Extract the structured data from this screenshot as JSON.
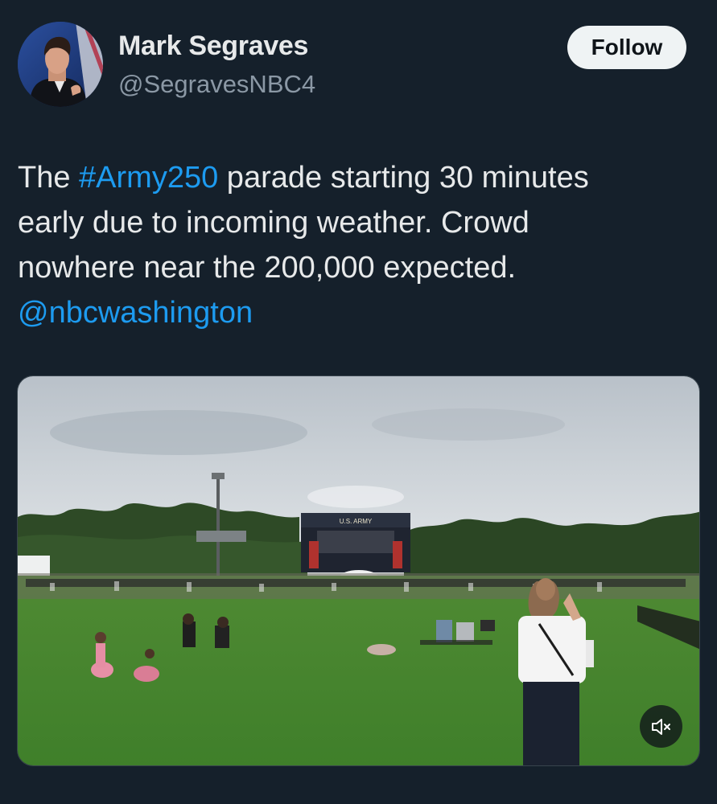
{
  "author": {
    "name": "Mark Segraves",
    "handle": "@SegravesNBC4",
    "avatar_icon": "profile-photo"
  },
  "follow_label": "Follow",
  "tweet": {
    "line1_pre": "The ",
    "hashtag": "#Army250",
    "line1_post": " parade starting 30 minutes",
    "line2": "early due to incoming weather. Crowd",
    "line3": "nowhere near the 200,000 expected.",
    "mention": "@nbcwashington"
  },
  "media": {
    "stage_banner": "U.S. ARMY",
    "mute_icon": "speaker-muted-icon"
  },
  "colors": {
    "background": "#15202b",
    "link": "#1d9bf0",
    "secondary_text": "#8b98a5",
    "follow_button": "#eff3f4"
  }
}
